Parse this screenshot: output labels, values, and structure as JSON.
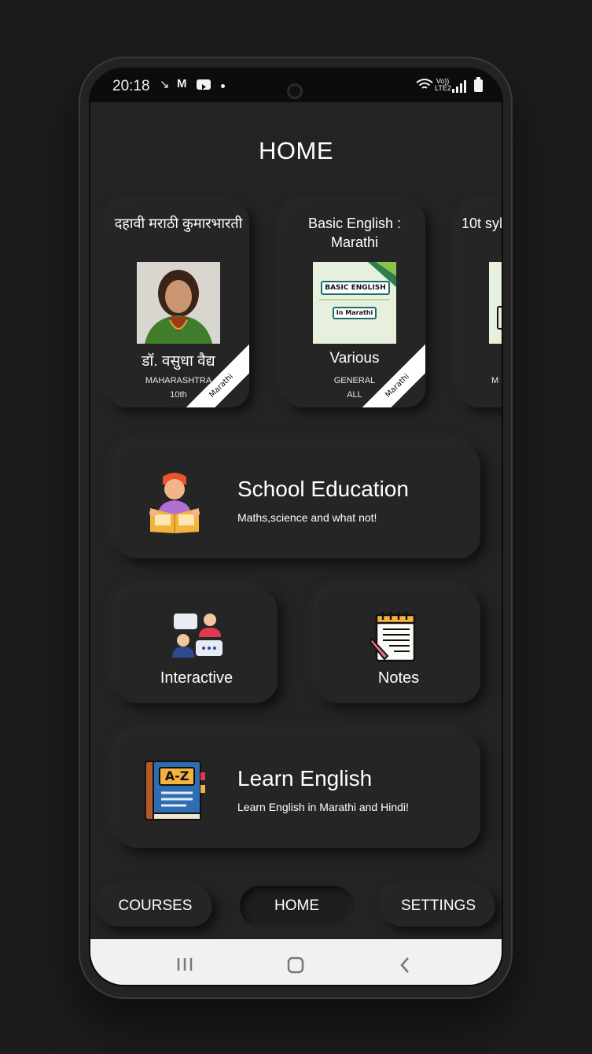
{
  "status": {
    "time": "20:18",
    "volte": "Vo)) LTE2"
  },
  "page": {
    "title": "HOME"
  },
  "courses": [
    {
      "title": "दहावी मराठी कुमारभारती",
      "author": "डॉ. वसुधा वैद्य",
      "board": "MAHARASHTRA",
      "grade": "10th",
      "language": "Marathi"
    },
    {
      "title": "Basic English : Marathi",
      "author": "Various",
      "board": "GENERAL",
      "grade": "ALL",
      "language": "Marathi",
      "thumb_line1": "BASIC ENGLISH",
      "thumb_line2": "In Marathi"
    },
    {
      "title": "10t syl",
      "board": "M"
    }
  ],
  "tiles": {
    "school": {
      "title": "School Education",
      "subtitle": "Maths,science and what not!"
    },
    "interactive": {
      "title": "Interactive"
    },
    "notes": {
      "title": "Notes"
    },
    "english": {
      "title": "Learn English",
      "subtitle": "Learn English in Marathi and Hindi!",
      "icon_text": "A-Z"
    }
  },
  "bottom_nav": {
    "courses": "COURSES",
    "home": "HOME",
    "settings": "SETTINGS"
  },
  "colors": {
    "background": "#232323",
    "card": "#252525",
    "text": "#ffffff"
  }
}
